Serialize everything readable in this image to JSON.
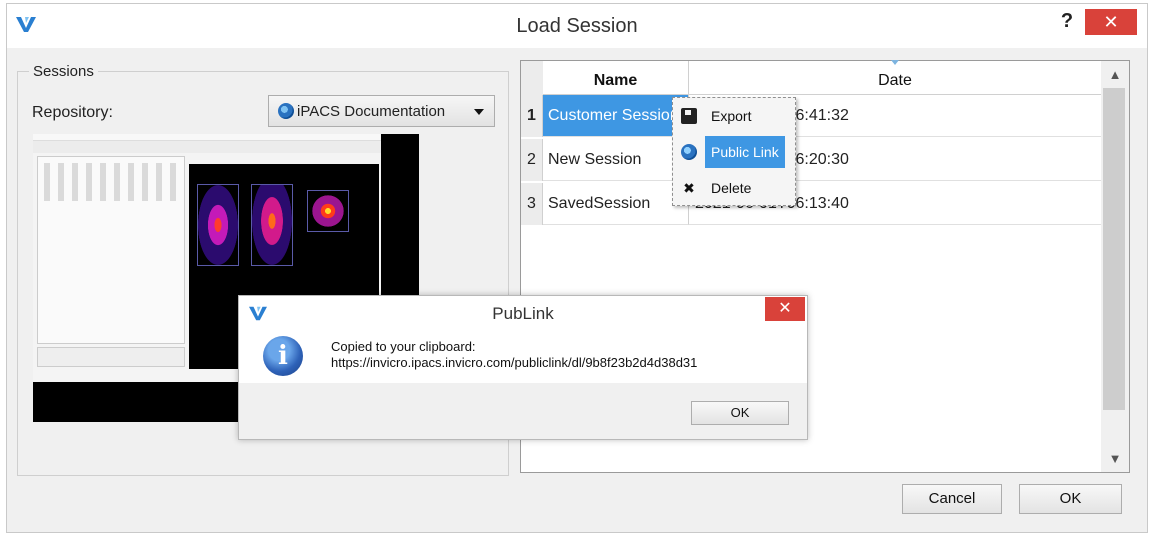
{
  "window": {
    "title": "Load Session",
    "help_label": "?",
    "close_label": "✕"
  },
  "sessions_group": {
    "title": "Sessions",
    "repository_label": "Repository:",
    "repository_value": "iPACS Documentation"
  },
  "table": {
    "headers": [
      "Name",
      "Date"
    ],
    "rows": [
      {
        "num": "1",
        "name": "Customer Session",
        "date": "2021-06-01T06:41:32",
        "selected": true
      },
      {
        "num": "2",
        "name": "New Session",
        "date": "2021-06-01T06:20:30",
        "selected": false
      },
      {
        "num": "3",
        "name": "SavedSession",
        "date": "2021-06-01T06:13:40",
        "selected": false
      }
    ]
  },
  "context_menu": {
    "items": [
      {
        "label": "Export",
        "icon": "save-icon"
      },
      {
        "label": "Public Link",
        "icon": "public-link-icon",
        "highlighted": true
      },
      {
        "label": "Delete",
        "icon": "delete-icon",
        "glyph": "✖"
      }
    ]
  },
  "buttons": {
    "cancel": "Cancel",
    "ok": "OK"
  },
  "publink_dialog": {
    "title": "PubLink",
    "close_label": "✕",
    "info_glyph": "i",
    "message_line1": "Copied to your clipboard:",
    "message_line2": "https://invicro.ipacs.invicro.com/publiclink/dl/9b8f23b2d4d38d31",
    "ok_label": "OK"
  },
  "colors": {
    "accent": "#3e97e3",
    "close_red": "#d9423a",
    "logo_blue": "#2a7fd1"
  }
}
